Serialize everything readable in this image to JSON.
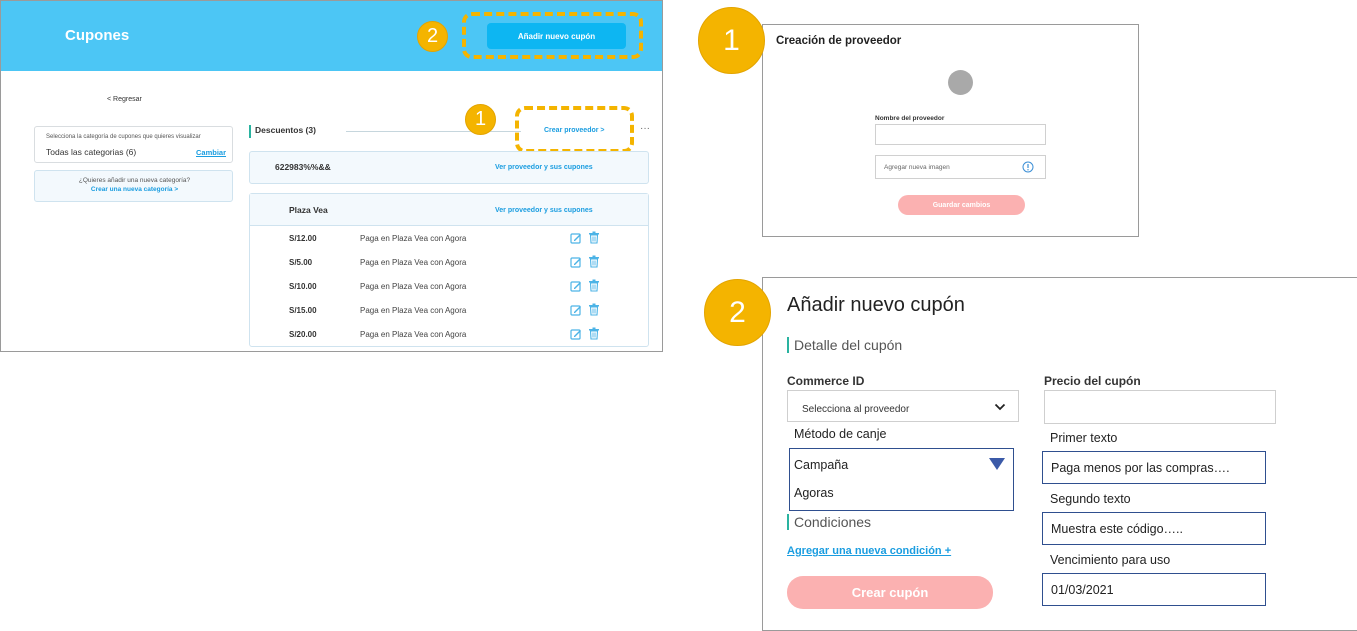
{
  "main": {
    "header": {
      "title": "Cupones",
      "add_coupon_label": "Añadir nuevo cupón"
    },
    "badges": {
      "one": "1",
      "two": "2"
    },
    "back_label": "<  Regresar",
    "category": {
      "hint": "Selecciona la categoría de cupones que quieres visualizar",
      "value": "Todas las categorias (6)",
      "change_label": "Cambiar"
    },
    "new_category": {
      "question": "¿Quieres añadir una nueva categoría?",
      "link": "Crear una nueva categoría >"
    },
    "discounts_title": "Descuentos (3)",
    "create_provider_label": "Crear proveedor >",
    "more_label": "···",
    "providers": [
      {
        "name": "622983%%&&",
        "link": "Ver proveedor y sus cupones"
      },
      {
        "name": "Plaza Vea",
        "link": "Ver proveedor y sus cupones"
      }
    ],
    "coupons": [
      {
        "amount": "S/12.00",
        "desc": "Paga en Plaza Vea con Agora"
      },
      {
        "amount": "S/5.00",
        "desc": "Paga en Plaza Vea con Agora"
      },
      {
        "amount": "S/10.00",
        "desc": "Paga en Plaza Vea con Agora"
      },
      {
        "amount": "S/15.00",
        "desc": "Paga en Plaza Vea con Agora"
      },
      {
        "amount": "S/20.00",
        "desc": "Paga en Plaza Vea con Agora"
      }
    ]
  },
  "panel1": {
    "badge": "1",
    "title": "Creación de proveedor",
    "name_label": "Nombre del proveedor",
    "image_label": "Agregar nueva imagen",
    "save_label": "Guardar cambios"
  },
  "panel2": {
    "badge": "2",
    "title": "Añadir nuevo cupón",
    "detail_title": "Detalle del cupón",
    "commerce_label": "Commerce ID",
    "commerce_placeholder": "Selecciona al proveedor",
    "price_label": "Precio del cupón",
    "method_label": "Método de canje",
    "method_options": [
      "Campaña",
      "Agoras"
    ],
    "conditions_title": "Condiciones",
    "add_condition_label": "Agregar una nueva condición +",
    "create_label": "Crear cupón",
    "first_text_label": "Primer texto",
    "first_text_value": "Paga menos  por las compras….",
    "second_text_label": "Segundo  texto",
    "second_text_value": "Muestra este código…..",
    "expiry_label": "Vencimiento para uso",
    "expiry_value": "01/03/2021"
  },
  "colors": {
    "header_bg": "#4cc6f5",
    "primary_button": "#0db6f2",
    "highlight": "#f4b400",
    "link": "#1a9de0",
    "disabled_button": "#fbb1b1",
    "accent_bar": "#2ab3a0"
  },
  "icons": [
    "edit-icon",
    "trash-icon",
    "info-icon",
    "chevron-down-icon",
    "dropdown-triangle-icon"
  ]
}
